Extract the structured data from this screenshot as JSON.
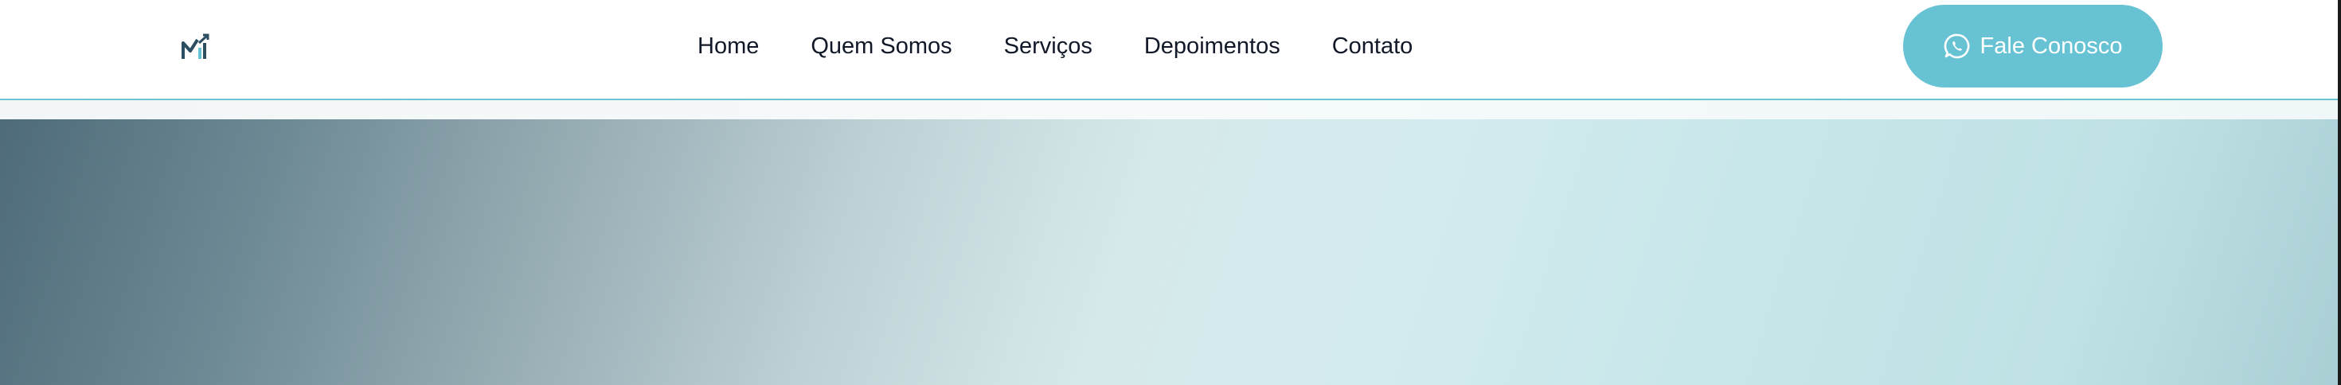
{
  "header": {
    "nav": [
      {
        "label": "Home"
      },
      {
        "label": "Quem Somos"
      },
      {
        "label": "Serviços"
      },
      {
        "label": "Depoimentos"
      },
      {
        "label": "Contato"
      }
    ],
    "cta": {
      "label": "Fale Conosco",
      "icon": "whatsapp-icon"
    },
    "logo_icon": "chart-logo-icon"
  },
  "colors": {
    "accent": "#67c3d3",
    "nav_text": "#111827",
    "hero_dark": "#4e6b7a",
    "hero_light": "#c5e6e9"
  }
}
